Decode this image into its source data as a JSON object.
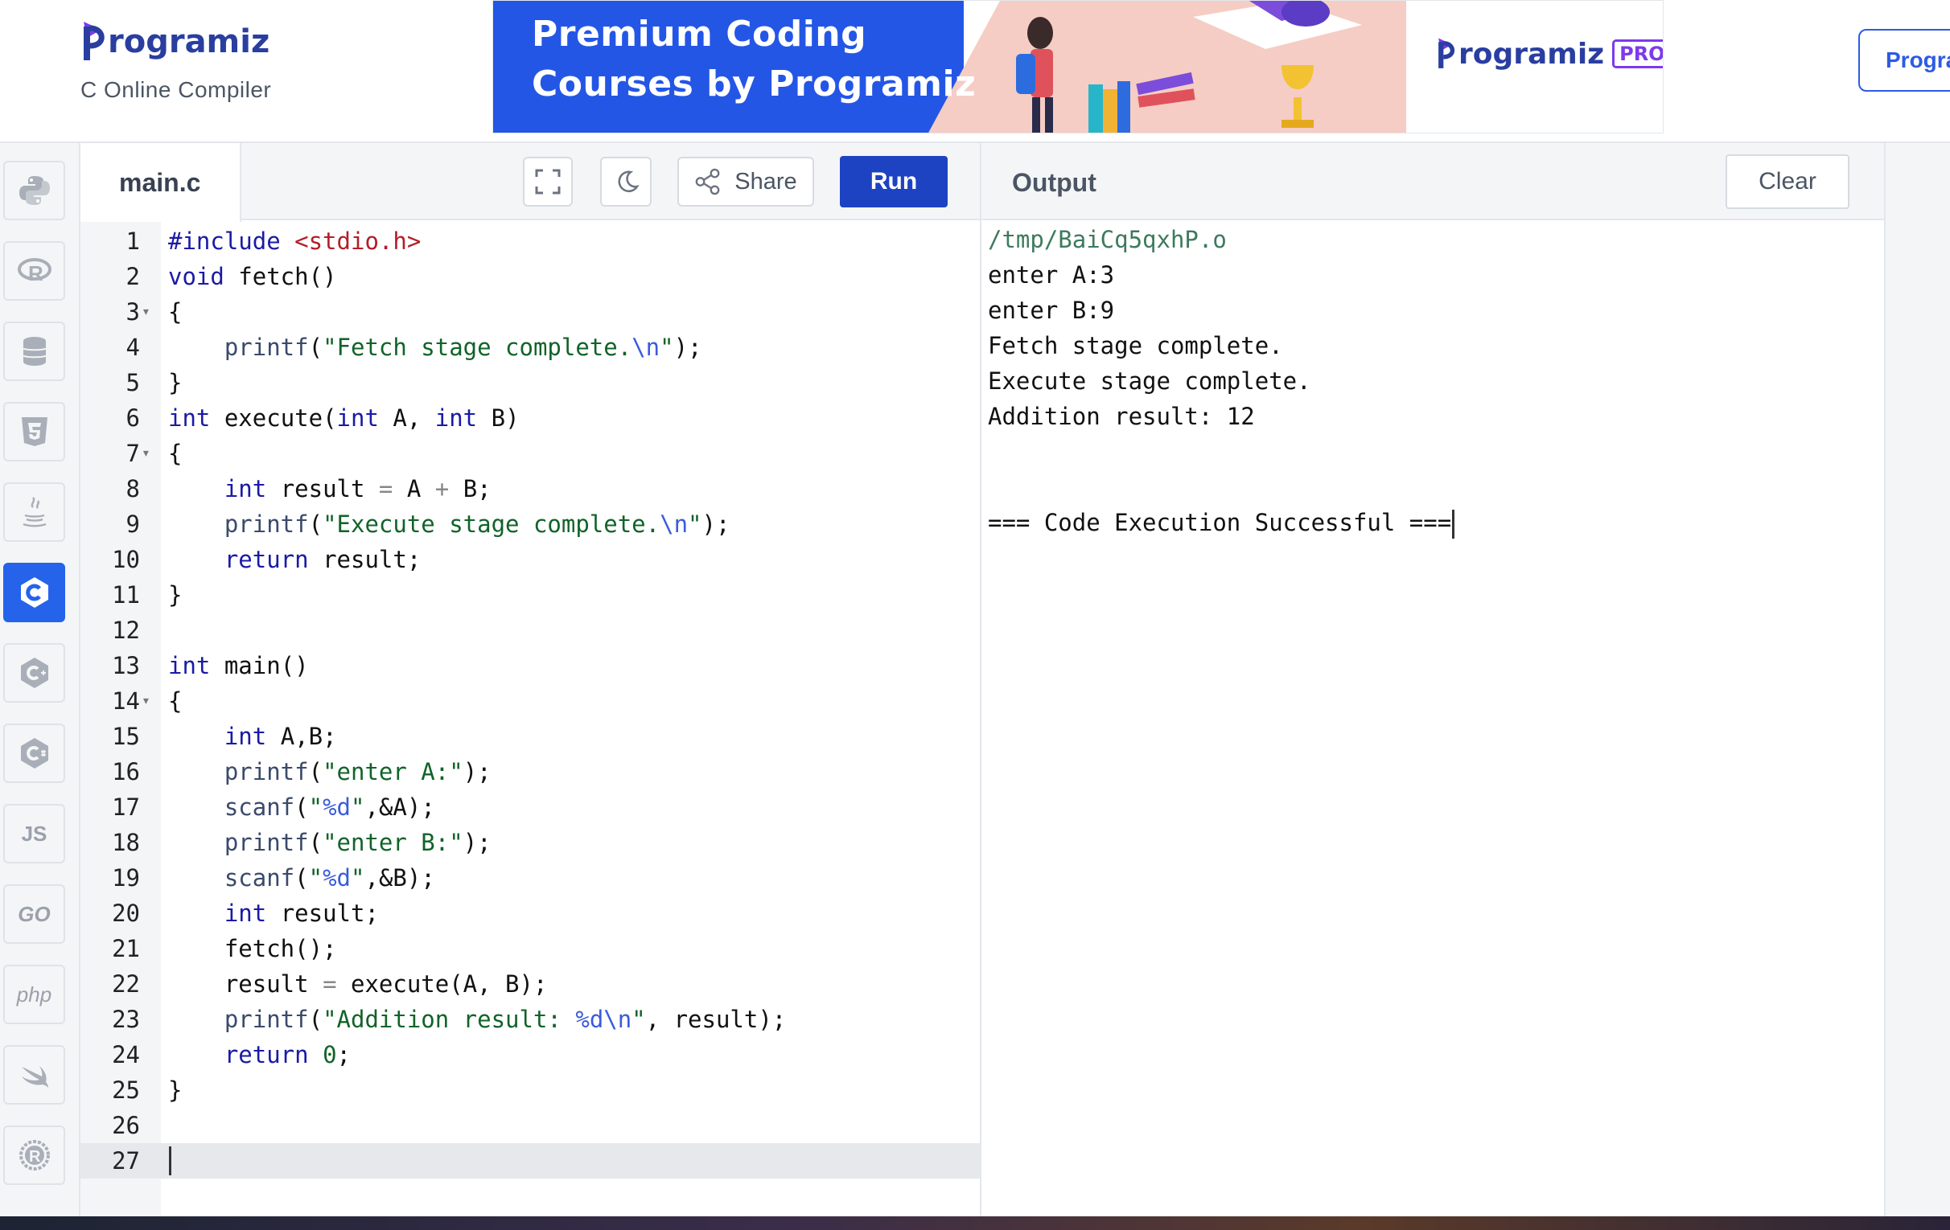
{
  "header": {
    "logo_text": "rogramiz",
    "subtitle": "C Online Compiler",
    "banner": {
      "line1": "Premium Coding",
      "line2": "Courses by Programiz",
      "brand_text": "rogramiz",
      "pro_badge": "PRO"
    },
    "pro_button_label": "Progra"
  },
  "languages": [
    {
      "name": "Python",
      "icon": "python-icon"
    },
    {
      "name": "R",
      "icon": "r-icon"
    },
    {
      "name": "SQL",
      "icon": "database-icon"
    },
    {
      "name": "HTML",
      "icon": "html5-icon"
    },
    {
      "name": "Java",
      "icon": "java-icon"
    },
    {
      "name": "C",
      "icon": "c-icon",
      "active": true
    },
    {
      "name": "C++",
      "icon": "cpp-icon"
    },
    {
      "name": "C#",
      "icon": "csharp-icon"
    },
    {
      "name": "JS",
      "icon": "js-icon",
      "label": "JS"
    },
    {
      "name": "Go",
      "icon": "go-icon",
      "label": "GO"
    },
    {
      "name": "PHP",
      "icon": "php-icon",
      "label": "php"
    },
    {
      "name": "Swift",
      "icon": "swift-icon"
    },
    {
      "name": "Rust",
      "icon": "rust-icon"
    }
  ],
  "editor": {
    "file_name": "main.c",
    "share_label": "Share",
    "run_label": "Run",
    "current_line": 27,
    "lines": [
      "#include <stdio.h>",
      "void fetch()",
      "{",
      "    printf(\"Fetch stage complete.\\n\");",
      "}",
      "int execute(int A, int B)",
      "{",
      "    int result = A + B;",
      "    printf(\"Execute stage complete.\\n\");",
      "    return result;",
      "}",
      "",
      "int main()",
      "{",
      "    int A,B;",
      "    printf(\"enter A:\");",
      "    scanf(\"%d\",&A);",
      "    printf(\"enter B:\");",
      "    scanf(\"%d\",&B);",
      "    int result;",
      "    fetch();",
      "    result = execute(A, B);",
      "    printf(\"Addition result: %d\\n\", result);",
      "    return 0;",
      "}",
      "",
      ""
    ],
    "foldable_lines": [
      3,
      7,
      14
    ]
  },
  "output": {
    "title": "Output",
    "clear_label": "Clear",
    "lines": [
      "/tmp/BaiCq5qxhP.o",
      "enter A:3",
      "enter B:9",
      "Fetch stage complete.",
      "Execute stage complete.",
      "Addition result: 12",
      "",
      "",
      "=== Code Execution Successful ==="
    ]
  },
  "colors": {
    "accent": "#2563eb",
    "run_button": "#1d43c2",
    "keyword": "#1a1aa6",
    "string": "#116329",
    "include": "#b31d28"
  }
}
